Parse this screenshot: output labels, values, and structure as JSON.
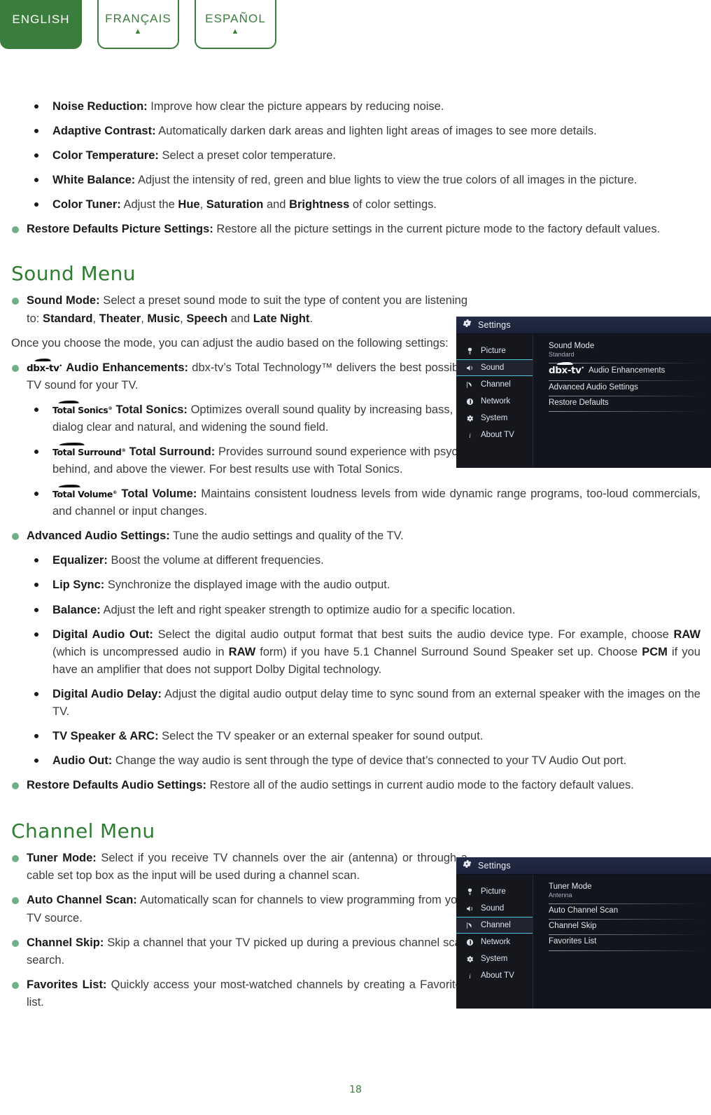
{
  "language_tabs": [
    {
      "label": "ENGLISH",
      "active": true,
      "caret": "▲"
    },
    {
      "label": "FRANÇAIS",
      "active": false,
      "caret": "▲"
    },
    {
      "label": "ESPAÑOL",
      "active": false,
      "caret": "▲"
    }
  ],
  "picture_section": {
    "bullets": [
      {
        "level": 2,
        "term": "Noise Reduction:",
        "text": " Improve how clear the picture appears by reducing noise."
      },
      {
        "level": 2,
        "term": "Adaptive Contrast:",
        "text": " Automatically darken dark areas and lighten light areas of images to see more details."
      },
      {
        "level": 2,
        "term": "Color Temperature:",
        "text": " Select a preset color temperature."
      },
      {
        "level": 2,
        "term": "White Balance:",
        "text": " Adjust the intensity of red, green and blue lights to view the true colors of all images in the picture."
      },
      {
        "level": 2,
        "term": "Color Tuner:",
        "text": " Adjust the Hue, Saturation and Brightness of color settings."
      },
      {
        "level": 1,
        "term": "Restore Defaults Picture Settings:",
        "text": " Restore all the picture settings in the current picture mode to the factory default values."
      }
    ]
  },
  "sound_section": {
    "heading": "Sound Menu",
    "sound_mode_term": "Sound Mode:",
    "sound_mode_text": " Select a preset sound mode to suit the type of content you are listening to: Standard, Theater, Music, Speech and Late Night.",
    "intro_paragraph": "Once you choose the mode, you can adjust the audio based on the following settings:",
    "audio_enh_term": "Audio Enhancements:",
    "audio_enh_text": " dbx-tv’s Total Technology™ delivers the best possible TV sound for your TV.",
    "total_sonics_term": "Total Sonics:",
    "total_sonics_text": " Optimizes overall sound quality by increasing bass, making dialog clear and natural, and widening the sound field.",
    "total_surround_term": "Total Surround:",
    "total_surround_text": " Provides surround sound experience with psycho-acoustic processing to place sounds beside, behind, and above the viewer. For best results use with Total Sonics.",
    "total_volume_term": "Total Volume:",
    "total_volume_text": " Maintains consistent loudness levels from wide dynamic range programs, too-loud commercials, and channel or input changes.",
    "advanced_term": "Advanced Audio Settings:",
    "advanced_text": " Tune the audio settings and quality of the TV.",
    "advanced_bullets": [
      {
        "term": "Equalizer:",
        "text": " Boost the volume at different frequencies."
      },
      {
        "term": "Lip Sync:",
        "text": " Synchronize the displayed image with the audio output."
      },
      {
        "term": "Balance:",
        "text": " Adjust the left and right speaker strength to optimize audio for a specific location."
      },
      {
        "term": "Digital Audio Out:",
        "text": " Select the digital audio output format that best suits the audio device type. For example, choose RAW (which is uncompressed audio in RAW form) if you have 5.1 Channel Surround Sound Speaker set up. Choose PCM if you have an amplifier that does not support Dolby Digital technology."
      },
      {
        "term": "Digital Audio Delay:",
        "text": " Adjust the digital audio output delay time to sync sound from an external speaker with the images on the TV."
      },
      {
        "term": "TV Speaker & ARC:",
        "text": " Select the TV speaker or an external speaker for sound output."
      },
      {
        "term": "Audio Out:",
        "text": " Change the way audio is sent through the type of device that’s connected to your TV Audio Out port."
      }
    ],
    "restore_term": "Restore Defaults Audio Settings:",
    "restore_text": " Restore all of the audio settings in current audio mode to the factory default values."
  },
  "channel_section": {
    "heading": "Channel Menu",
    "bullets": [
      {
        "term": "Tuner Mode:",
        "text": " Select if you receive TV channels over the air (antenna) or through a cable set top box as the input will be used during a channel scan."
      },
      {
        "term": "Auto Channel Scan:",
        "text": " Automatically scan for channels to view programming from your TV source."
      },
      {
        "term": "Channel Skip:",
        "text": " Skip a channel that your TV picked up during a previous channel scan search."
      },
      {
        "term": "Favorites List:",
        "text": " Quickly access your most-watched channels by creating a Favorites list."
      }
    ]
  },
  "tv_menu_sound": {
    "title": "Settings",
    "sidebar": [
      {
        "label": "Picture",
        "icon": "picture-icon",
        "selected": false
      },
      {
        "label": "Sound",
        "icon": "speaker-icon",
        "selected": true
      },
      {
        "label": "Channel",
        "icon": "antenna-icon",
        "selected": false
      },
      {
        "label": "Network",
        "icon": "network-icon",
        "selected": false
      },
      {
        "label": "System",
        "icon": "gear-icon",
        "selected": false
      },
      {
        "label": "About TV",
        "icon": "info-icon",
        "selected": false
      }
    ],
    "rows": [
      {
        "label": "Sound Mode",
        "value": "Standard",
        "logo": false
      },
      {
        "label": "Audio Enhancements",
        "value": "",
        "logo": true
      },
      {
        "label": "Advanced Audio Settings",
        "value": "",
        "logo": false
      },
      {
        "label": "Restore Defaults",
        "value": "",
        "logo": false
      }
    ]
  },
  "tv_menu_channel": {
    "title": "Settings",
    "sidebar": [
      {
        "label": "Picture",
        "icon": "picture-icon",
        "selected": false
      },
      {
        "label": "Sound",
        "icon": "speaker-icon",
        "selected": false
      },
      {
        "label": "Channel",
        "icon": "antenna-icon",
        "selected": true
      },
      {
        "label": "Network",
        "icon": "network-icon",
        "selected": false
      },
      {
        "label": "System",
        "icon": "gear-icon",
        "selected": false
      },
      {
        "label": "About TV",
        "icon": "info-icon",
        "selected": false
      }
    ],
    "rows": [
      {
        "label": "Tuner Mode",
        "value": "Antenna",
        "logo": false
      },
      {
        "label": "Auto Channel Scan",
        "value": "",
        "logo": false
      },
      {
        "label": "Channel Skip",
        "value": "",
        "logo": false
      },
      {
        "label": "Favorites List",
        "value": "",
        "logo": false
      }
    ]
  },
  "brand_marks": {
    "dbx_tv": "dbx-tv",
    "dbx_tv_sup": "•",
    "total_sonics": "Total Sonics",
    "total_sonics_sup": "®",
    "total_surround": "Total Surround",
    "total_surround_sup": "®",
    "total_volume": "Total Volume",
    "total_volume_sup": "®"
  },
  "footer": {
    "page_number": "18"
  },
  "colors": {
    "brand_green": "#3a7d3c",
    "heading_green": "#2f7d32",
    "bullet_green": "#6fb186",
    "tv_accent_cyan": "#4fc3d9",
    "tv_bg": "#12151d"
  }
}
